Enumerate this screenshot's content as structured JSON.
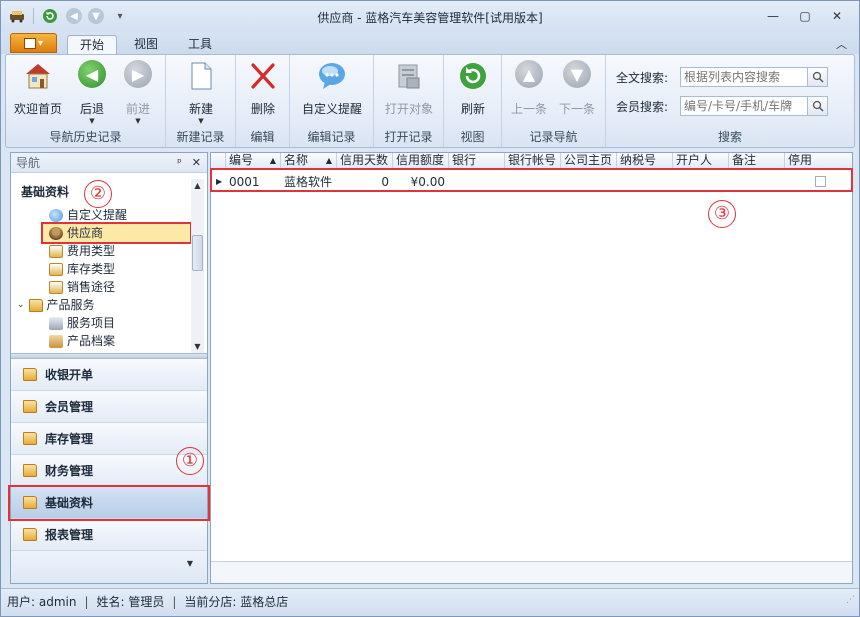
{
  "window": {
    "title": "供应商 - 蓝格汽车美容管理软件[试用版本]",
    "controls": [
      "—",
      "▢",
      "✕"
    ]
  },
  "tabs": [
    "开始",
    "视图",
    "工具"
  ],
  "ribbon": {
    "groups": [
      {
        "label": "导航历史记录",
        "buttons": [
          "欢迎首页",
          "后退",
          "前进"
        ]
      },
      {
        "label": "新建记录",
        "buttons": [
          "新建"
        ]
      },
      {
        "label": "编辑",
        "buttons": [
          "删除"
        ]
      },
      {
        "label": "编辑记录",
        "buttons": [
          "自定义提醒"
        ]
      },
      {
        "label": "打开记录",
        "buttons": [
          "打开对象"
        ]
      },
      {
        "label": "视图",
        "buttons": [
          "刷新"
        ]
      },
      {
        "label": "记录导航",
        "buttons": [
          "上一条",
          "下一条"
        ]
      },
      {
        "label": "搜索"
      }
    ],
    "search": {
      "fulltext_label": "全文搜索:",
      "fulltext_placeholder": "根据列表内容搜索",
      "member_label": "会员搜索:",
      "member_placeholder": "编号/卡号/手机/车牌"
    }
  },
  "nav": {
    "header": "导航",
    "pin": "ᵖ",
    "close": "✕",
    "section_title": "基础资料",
    "tree": [
      {
        "label": "自定义提醒",
        "icon": "reminder-icon",
        "level": 2
      },
      {
        "label": "供应商",
        "icon": "supplier-icon",
        "level": 2,
        "selected": true
      },
      {
        "label": "费用类型",
        "icon": "document-icon",
        "level": 2
      },
      {
        "label": "库存类型",
        "icon": "document-icon",
        "level": 2
      },
      {
        "label": "销售途径",
        "icon": "document-icon",
        "level": 2
      },
      {
        "label": "产品服务",
        "icon": "folder-icon",
        "level": 1,
        "expanded": true
      },
      {
        "label": "服务项目",
        "icon": "service-icon",
        "level": 2
      },
      {
        "label": "产品档案",
        "icon": "box-icon",
        "level": 2
      }
    ],
    "modules": [
      "收银开单",
      "会员管理",
      "库存管理",
      "财务管理",
      "基础资料",
      "报表管理"
    ],
    "active_module": "基础资料"
  },
  "grid": {
    "columns": [
      "编号",
      "名称",
      "信用天数",
      "信用额度",
      "银行",
      "银行帐号",
      "公司主页",
      "纳税号",
      "开户人",
      "备注",
      "停用"
    ],
    "rows": [
      {
        "编号": "0001",
        "名称": "蓝格软件",
        "信用天数": "0",
        "信用额度": "¥0.00",
        "银行": "",
        "银行帐号": "",
        "公司主页": "",
        "纳税号": "",
        "开户人": "",
        "备注": "",
        "停用": false
      }
    ]
  },
  "annotations": {
    "one": "①",
    "two": "②",
    "three": "③"
  },
  "status": {
    "user": "用户: admin",
    "name": "姓名: 管理员",
    "branch": "当前分店: 蓝格总店",
    "separator": "|"
  },
  "colors": {
    "accent_orange": "#e07d0c",
    "annotation_red": "#e2333a",
    "selection_yellow": "#fde9a7"
  }
}
